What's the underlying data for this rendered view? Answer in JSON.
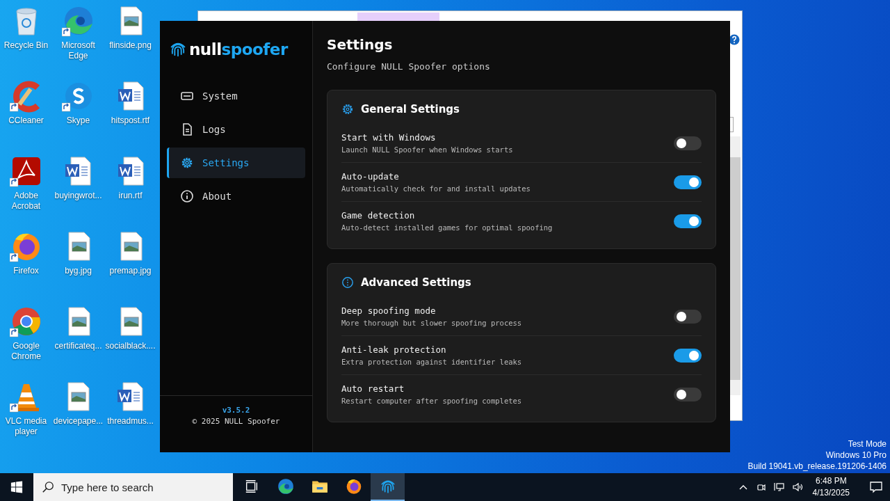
{
  "desktop": {
    "icons": [
      {
        "label": "Recycle Bin",
        "kind": "recycle",
        "shortcut": false
      },
      {
        "label": "Microsoft Edge",
        "kind": "edge",
        "shortcut": true
      },
      {
        "label": "flinside.png",
        "kind": "image",
        "shortcut": false
      },
      {
        "label": "CCleaner",
        "kind": "ccleaner",
        "shortcut": true
      },
      {
        "label": "Skype",
        "kind": "skype",
        "shortcut": true
      },
      {
        "label": "hitspost.rtf",
        "kind": "word",
        "shortcut": false
      },
      {
        "label": "Adobe Acrobat",
        "kind": "acrobat",
        "shortcut": true
      },
      {
        "label": "buyingwrot...",
        "kind": "word",
        "shortcut": false
      },
      {
        "label": "irun.rtf",
        "kind": "word",
        "shortcut": false
      },
      {
        "label": "Firefox",
        "kind": "firefox",
        "shortcut": true
      },
      {
        "label": "byg.jpg",
        "kind": "image",
        "shortcut": false
      },
      {
        "label": "premap.jpg",
        "kind": "image",
        "shortcut": false
      },
      {
        "label": "Google Chrome",
        "kind": "chrome",
        "shortcut": true
      },
      {
        "label": "certificateq...",
        "kind": "image",
        "shortcut": false
      },
      {
        "label": "socialblack....",
        "kind": "image",
        "shortcut": false
      },
      {
        "label": "VLC media player",
        "kind": "vlc",
        "shortcut": true
      },
      {
        "label": "devicepape...",
        "kind": "image",
        "shortcut": false
      },
      {
        "label": "threadmus...",
        "kind": "word",
        "shortcut": false
      }
    ],
    "system_notice": [
      "Test Mode",
      "Windows 10 Pro",
      "Build 19041.vb_release.191206-1406"
    ]
  },
  "app": {
    "logo": {
      "part_1": "null",
      "part_2": "spoofer"
    },
    "nav": [
      {
        "label": "System",
        "kind": "monitor",
        "selected": false
      },
      {
        "label": "Logs",
        "kind": "document",
        "selected": false
      },
      {
        "label": "Settings",
        "kind": "gear",
        "selected": true
      },
      {
        "label": "About",
        "kind": "info",
        "selected": false
      }
    ],
    "footer": {
      "version": "v3.5.2",
      "copyright": "© 2025 NULL Spoofer"
    },
    "page": {
      "title": "Settings",
      "subtitle": "Configure NULL Spoofer options"
    },
    "sections": [
      {
        "title": "General Settings",
        "kind": "gear",
        "settings": [
          {
            "label": "Start with Windows",
            "description": "Launch NULL Spoofer when Windows starts",
            "on": false
          },
          {
            "label": "Auto-update",
            "description": "Automatically check for and install updates",
            "on": true
          },
          {
            "label": "Game detection",
            "description": "Auto-detect installed games for optimal spoofing",
            "on": true
          }
        ]
      },
      {
        "title": "Advanced Settings",
        "kind": "info",
        "settings": [
          {
            "label": "Deep spoofing mode",
            "description": "More thorough but slower spoofing process",
            "on": false
          },
          {
            "label": "Anti-leak protection",
            "description": "Extra protection against identifier leaks",
            "on": true
          },
          {
            "label": "Auto restart",
            "description": "Restart computer after spoofing completes",
            "on": false
          }
        ]
      }
    ]
  },
  "taskbar": {
    "search": {
      "placeholder": "Type here to search"
    },
    "apps": [
      {
        "kind": "taskview",
        "selected": false
      },
      {
        "kind": "edge",
        "selected": false
      },
      {
        "kind": "folder",
        "selected": false
      },
      {
        "kind": "firefox",
        "selected": false
      },
      {
        "kind": "fingerprint",
        "selected": true
      }
    ],
    "clock": {
      "time": "6:48 PM",
      "date": "4/13/2025"
    }
  }
}
